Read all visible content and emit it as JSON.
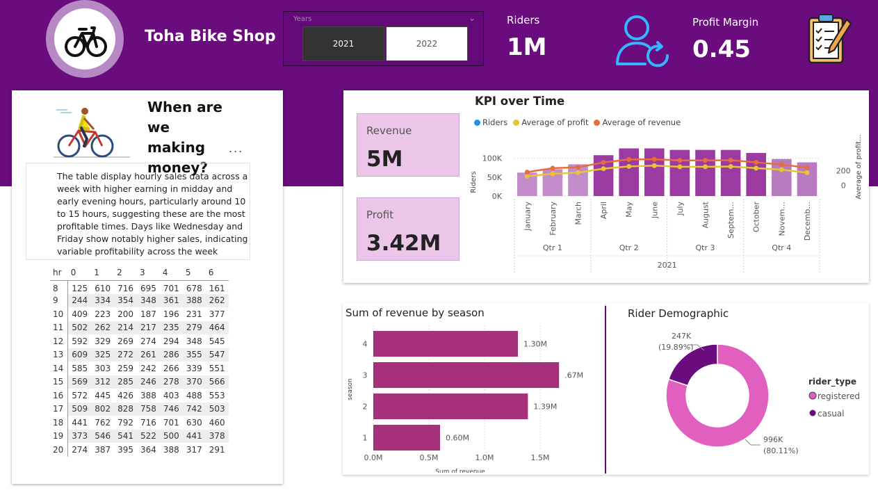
{
  "header": {
    "shop_title": "Toha Bike Shop",
    "slicer": {
      "label": "Years",
      "options": [
        "2021",
        "2022"
      ],
      "selected": "2021"
    },
    "riders": {
      "label": "Riders",
      "value": "1M"
    },
    "profit_margin": {
      "label": "Profit Margin",
      "value": "0.45"
    }
  },
  "colors": {
    "header_band": "#6a0b7e",
    "bar": "#9b3aa1",
    "profit_line": "#e6c435",
    "revenue_line": "#e76e3c",
    "riders_dot": "#1f8ff0",
    "season_bar": "#a6317a",
    "registered": "#e05fbf",
    "casual": "#6a0b7e"
  },
  "icons": [
    "bicycle-icon",
    "user-refresh-icon",
    "clipboard-checklist-icon"
  ],
  "hourly_card": {
    "title": "When are we making money?",
    "more_label": "...",
    "description": "The table display hourly sales data across a week with higher earning in midday and early evening hours, particularly around 10 to 15 hours, suggesting these are the most profitable times. Days like Wednesday and Friday show notably higher sales, indicating variable profitability across the week",
    "table": {
      "corner": "hr",
      "columns": [
        "0",
        "1",
        "2",
        "3",
        "4",
        "5",
        "6"
      ],
      "rows": [
        {
          "hr": "8",
          "values": [
            "125",
            "610",
            "716",
            "695",
            "701",
            "678",
            "161"
          ]
        },
        {
          "hr": "9",
          "values": [
            "244",
            "334",
            "354",
            "348",
            "361",
            "388",
            "262"
          ]
        },
        {
          "hr": "10",
          "values": [
            "409",
            "223",
            "200",
            "187",
            "196",
            "231",
            "377"
          ]
        },
        {
          "hr": "11",
          "values": [
            "502",
            "262",
            "214",
            "217",
            "235",
            "279",
            "464"
          ]
        },
        {
          "hr": "12",
          "values": [
            "592",
            "329",
            "269",
            "274",
            "294",
            "348",
            "545"
          ]
        },
        {
          "hr": "13",
          "values": [
            "609",
            "325",
            "272",
            "261",
            "286",
            "355",
            "547"
          ]
        },
        {
          "hr": "14",
          "values": [
            "585",
            "303",
            "259",
            "242",
            "266",
            "339",
            "551"
          ]
        },
        {
          "hr": "15",
          "values": [
            "569",
            "312",
            "285",
            "246",
            "278",
            "370",
            "566"
          ]
        },
        {
          "hr": "16",
          "values": [
            "572",
            "445",
            "426",
            "388",
            "403",
            "488",
            "553"
          ]
        },
        {
          "hr": "17",
          "values": [
            "509",
            "802",
            "828",
            "758",
            "746",
            "742",
            "503"
          ]
        },
        {
          "hr": "18",
          "values": [
            "441",
            "762",
            "792",
            "716",
            "701",
            "630",
            "460"
          ]
        },
        {
          "hr": "19",
          "values": [
            "373",
            "546",
            "541",
            "522",
            "500",
            "441",
            "378"
          ]
        },
        {
          "hr": "20",
          "values": [
            "274",
            "387",
            "395",
            "364",
            "388",
            "317",
            "291"
          ]
        }
      ]
    }
  },
  "kpi_cards": {
    "revenue": {
      "label": "Revenue",
      "value": "5M"
    },
    "profit": {
      "label": "Profit",
      "value": "3.42M"
    }
  },
  "kpi_chart_title": "KPI over Time",
  "season_chart_title": "Sum of revenue by season",
  "demographic_title": "Rider Demographic",
  "chart_data": [
    {
      "type": "bar",
      "title": "KPI over Time",
      "legend": [
        "Riders",
        "Average of profit",
        "Average of revenue"
      ],
      "legend_position": "top-left",
      "categories": [
        "January",
        "February",
        "March",
        "April",
        "May",
        "June",
        "July",
        "August",
        "Septem...",
        "October",
        "Novem...",
        "Decemb..."
      ],
      "quarters": [
        "Qtr 1",
        "Qtr 2",
        "Qtr 3",
        "Qtr 4"
      ],
      "year": "2021",
      "ylabel": "Riders",
      "y2label": "Average of profit...",
      "y_ticks": [
        "0K",
        "50K",
        "100K"
      ],
      "y2_ticks": [
        "0",
        "200"
      ],
      "ylim": [
        0,
        125000
      ],
      "y2lim": [
        -150,
        500
      ],
      "series": [
        {
          "name": "Riders",
          "axis": "left",
          "values": [
            62000,
            71000,
            84000,
            108000,
            126000,
            126000,
            122000,
            122000,
            122000,
            114000,
            98000,
            89000
          ]
        },
        {
          "name": "Average of profit",
          "axis": "right",
          "values": [
            122,
            156,
            172,
            226,
            258,
            268,
            253,
            253,
            256,
            233,
            213,
            171
          ]
        },
        {
          "name": "Average of revenue",
          "axis": "right",
          "values": [
            179,
            233,
            245,
            313,
            353,
            356,
            340,
            340,
            343,
            313,
            282,
            240
          ]
        }
      ],
      "grid": true
    },
    {
      "type": "bar",
      "orientation": "horizontal",
      "title": "Sum of revenue by season",
      "categories": [
        "4",
        "3",
        "2",
        "1"
      ],
      "values": [
        1.3,
        1.67,
        1.39,
        0.6
      ],
      "data_labels": [
        "1.30M",
        ".67M",
        "1.39M",
        "0.60M"
      ],
      "x_ticks": [
        "0.0M",
        "0.5M",
        "1.0M",
        "1.5M"
      ],
      "xlim": [
        0,
        1.75
      ],
      "xlabel": "Sum of revenue",
      "ylabel": "season",
      "grid": true
    },
    {
      "type": "pie",
      "title": "Rider Demographic",
      "legend_title": "rider_type",
      "legend_position": "right",
      "slices": [
        {
          "name": "registered",
          "value": 996000,
          "label": "996K",
          "pct": "(80.11%)"
        },
        {
          "name": "casual",
          "value": 247000,
          "label": "247K",
          "pct": "(19.89%)"
        }
      ]
    }
  ]
}
